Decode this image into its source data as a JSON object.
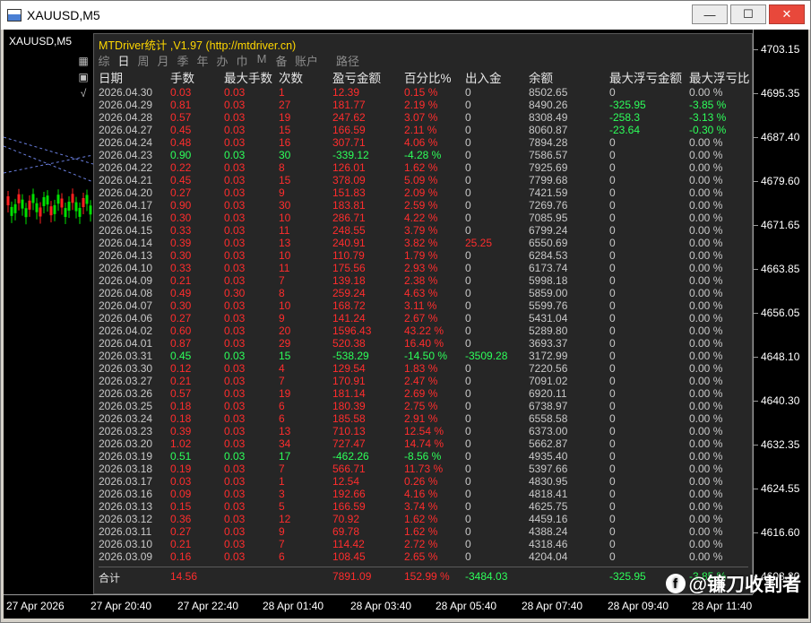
{
  "window": {
    "title": "XAUUSD,M5",
    "buttons": {
      "minimize": "—",
      "maximize": "☐",
      "close": "✕"
    }
  },
  "chart": {
    "symbol": "XAUUSD,M5",
    "price_ticks": [
      "4703.15",
      "4695.35",
      "4687.40",
      "4679.60",
      "4671.65",
      "4663.85",
      "4656.05",
      "4648.10",
      "4640.30",
      "4632.35",
      "4624.55",
      "4616.60",
      "4608.80"
    ],
    "time_ticks": [
      "27 Apr 2026",
      "27 Apr 20:40",
      "27 Apr 22:40",
      "28 Apr 01:40",
      "28 Apr 03:40",
      "28 Apr 05:40",
      "28 Apr 07:40",
      "28 Apr 09:40",
      "28 Apr 11:40"
    ]
  },
  "panel": {
    "title": "MTDriver统计 ,V1.97 (http://mtdriver.cn)",
    "tabs": [
      "综",
      "日",
      "周",
      "月",
      "季",
      "年",
      "办",
      "巾",
      "M",
      "备",
      "账户",
      "路径"
    ],
    "active_tab_index": 1,
    "side_icons": [
      "grid-icon",
      "disk-icon",
      "check-icon"
    ],
    "side_glyphs": [
      "▦",
      "▣",
      "√"
    ],
    "headers": [
      "日期",
      "手数",
      "最大手数",
      "次数",
      "盈亏金额",
      "百分比%",
      "出入金",
      "余额",
      "最大浮亏金额",
      "最大浮亏比"
    ],
    "rows": [
      [
        "2026.04.30",
        "0.03",
        "0.03",
        "1",
        "12.39",
        "0.15 %",
        "0",
        "8502.65",
        "0",
        "0.00 %"
      ],
      [
        "2026.04.29",
        "0.81",
        "0.03",
        "27",
        "181.77",
        "2.19 %",
        "0",
        "8490.26",
        "-325.95",
        "-3.85 %"
      ],
      [
        "2026.04.28",
        "0.57",
        "0.03",
        "19",
        "247.62",
        "3.07 %",
        "0",
        "8308.49",
        "-258.3",
        "-3.13 %"
      ],
      [
        "2026.04.27",
        "0.45",
        "0.03",
        "15",
        "166.59",
        "2.11 %",
        "0",
        "8060.87",
        "-23.64",
        "-0.30 %"
      ],
      [
        "2026.04.24",
        "0.48",
        "0.03",
        "16",
        "307.71",
        "4.06 %",
        "0",
        "7894.28",
        "0",
        "0.00 %"
      ],
      [
        "2026.04.23",
        "0.90",
        "0.03",
        "30",
        "-339.12",
        "-4.28 %",
        "0",
        "7586.57",
        "0",
        "0.00 %"
      ],
      [
        "2026.04.22",
        "0.22",
        "0.03",
        "8",
        "126.01",
        "1.62 %",
        "0",
        "7925.69",
        "0",
        "0.00 %"
      ],
      [
        "2026.04.21",
        "0.45",
        "0.03",
        "15",
        "378.09",
        "5.09 %",
        "0",
        "7799.68",
        "0",
        "0.00 %"
      ],
      [
        "2026.04.20",
        "0.27",
        "0.03",
        "9",
        "151.83",
        "2.09 %",
        "0",
        "7421.59",
        "0",
        "0.00 %"
      ],
      [
        "2026.04.17",
        "0.90",
        "0.03",
        "30",
        "183.81",
        "2.59 %",
        "0",
        "7269.76",
        "0",
        "0.00 %"
      ],
      [
        "2026.04.16",
        "0.30",
        "0.03",
        "10",
        "286.71",
        "4.22 %",
        "0",
        "7085.95",
        "0",
        "0.00 %"
      ],
      [
        "2026.04.15",
        "0.33",
        "0.03",
        "11",
        "248.55",
        "3.79 %",
        "0",
        "6799.24",
        "0",
        "0.00 %"
      ],
      [
        "2026.04.14",
        "0.39",
        "0.03",
        "13",
        "240.91",
        "3.82 %",
        "25.25",
        "6550.69",
        "0",
        "0.00 %"
      ],
      [
        "2026.04.13",
        "0.30",
        "0.03",
        "10",
        "110.79",
        "1.79 %",
        "0",
        "6284.53",
        "0",
        "0.00 %"
      ],
      [
        "2026.04.10",
        "0.33",
        "0.03",
        "11",
        "175.56",
        "2.93 %",
        "0",
        "6173.74",
        "0",
        "0.00 %"
      ],
      [
        "2026.04.09",
        "0.21",
        "0.03",
        "7",
        "139.18",
        "2.38 %",
        "0",
        "5998.18",
        "0",
        "0.00 %"
      ],
      [
        "2026.04.08",
        "0.49",
        "0.30",
        "8",
        "259.24",
        "4.63 %",
        "0",
        "5859.00",
        "0",
        "0.00 %"
      ],
      [
        "2026.04.07",
        "0.30",
        "0.03",
        "10",
        "168.72",
        "3.11 %",
        "0",
        "5599.76",
        "0",
        "0.00 %"
      ],
      [
        "2026.04.06",
        "0.27",
        "0.03",
        "9",
        "141.24",
        "2.67 %",
        "0",
        "5431.04",
        "0",
        "0.00 %"
      ],
      [
        "2026.04.02",
        "0.60",
        "0.03",
        "20",
        "1596.43",
        "43.22 %",
        "0",
        "5289.80",
        "0",
        "0.00 %"
      ],
      [
        "2026.04.01",
        "0.87",
        "0.03",
        "29",
        "520.38",
        "16.40 %",
        "0",
        "3693.37",
        "0",
        "0.00 %"
      ],
      [
        "2026.03.31",
        "0.45",
        "0.03",
        "15",
        "-538.29",
        "-14.50 %",
        "-3509.28",
        "3172.99",
        "0",
        "0.00 %"
      ],
      [
        "2026.03.30",
        "0.12",
        "0.03",
        "4",
        "129.54",
        "1.83 %",
        "0",
        "7220.56",
        "0",
        "0.00 %"
      ],
      [
        "2026.03.27",
        "0.21",
        "0.03",
        "7",
        "170.91",
        "2.47 %",
        "0",
        "7091.02",
        "0",
        "0.00 %"
      ],
      [
        "2026.03.26",
        "0.57",
        "0.03",
        "19",
        "181.14",
        "2.69 %",
        "0",
        "6920.11",
        "0",
        "0.00 %"
      ],
      [
        "2026.03.25",
        "0.18",
        "0.03",
        "6",
        "180.39",
        "2.75 %",
        "0",
        "6738.97",
        "0",
        "0.00 %"
      ],
      [
        "2026.03.24",
        "0.18",
        "0.03",
        "6",
        "185.58",
        "2.91 %",
        "0",
        "6558.58",
        "0",
        "0.00 %"
      ],
      [
        "2026.03.23",
        "0.39",
        "0.03",
        "13",
        "710.13",
        "12.54 %",
        "0",
        "6373.00",
        "0",
        "0.00 %"
      ],
      [
        "2026.03.20",
        "1.02",
        "0.03",
        "34",
        "727.47",
        "14.74 %",
        "0",
        "5662.87",
        "0",
        "0.00 %"
      ],
      [
        "2026.03.19",
        "0.51",
        "0.03",
        "17",
        "-462.26",
        "-8.56 %",
        "0",
        "4935.40",
        "0",
        "0.00 %"
      ],
      [
        "2026.03.18",
        "0.19",
        "0.03",
        "7",
        "566.71",
        "11.73 %",
        "0",
        "5397.66",
        "0",
        "0.00 %"
      ],
      [
        "2026.03.17",
        "0.03",
        "0.03",
        "1",
        "12.54",
        "0.26 %",
        "0",
        "4830.95",
        "0",
        "0.00 %"
      ],
      [
        "2026.03.16",
        "0.09",
        "0.03",
        "3",
        "192.66",
        "4.16 %",
        "0",
        "4818.41",
        "0",
        "0.00 %"
      ],
      [
        "2026.03.13",
        "0.15",
        "0.03",
        "5",
        "166.59",
        "3.74 %",
        "0",
        "4625.75",
        "0",
        "0.00 %"
      ],
      [
        "2026.03.12",
        "0.36",
        "0.03",
        "12",
        "70.92",
        "1.62 %",
        "0",
        "4459.16",
        "0",
        "0.00 %"
      ],
      [
        "2026.03.11",
        "0.27",
        "0.03",
        "9",
        "69.78",
        "1.62 %",
        "0",
        "4388.24",
        "0",
        "0.00 %"
      ],
      [
        "2026.03.10",
        "0.21",
        "0.03",
        "7",
        "114.42",
        "2.72 %",
        "0",
        "4318.46",
        "0",
        "0.00 %"
      ],
      [
        "2026.03.09",
        "0.16",
        "0.03",
        "6",
        "108.45",
        "2.65 %",
        "0",
        "4204.04",
        "0",
        "0.00 %"
      ]
    ],
    "total": {
      "label": "合计",
      "lots": "14.56",
      "pnl": "7891.09",
      "pct": "152.99 %",
      "flow": "-3484.03",
      "max_float_loss": "-325.95",
      "max_float_pct": "-3.85 %"
    }
  },
  "watermark": {
    "logo": "f",
    "text": "@镰刀收割者"
  },
  "colors": {
    "profit": "#ff2d2d",
    "loss": "#2dff5a",
    "title": "#ffd700",
    "panel_bg": "#262626"
  }
}
